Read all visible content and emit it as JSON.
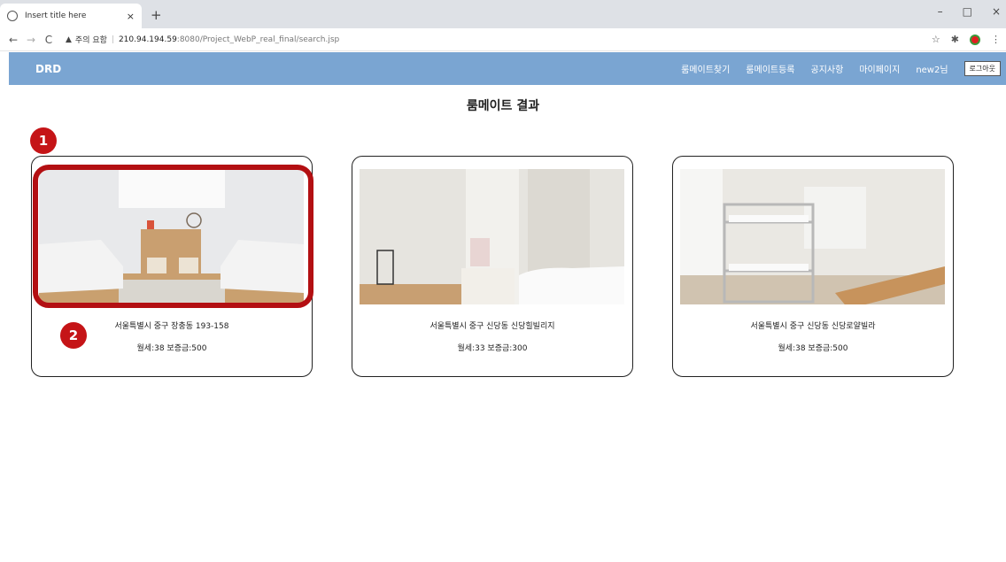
{
  "browser": {
    "tab_title": "Insert title here",
    "tab_close": "×",
    "new_tab": "+",
    "window_controls": [
      "–",
      "□",
      "×"
    ],
    "security_warning": "주의 요함",
    "url_host": "210.94.194.59",
    "url_path": ":8080/Project_WebP_real_final/search.jsp",
    "icons": [
      "back-icon",
      "forward-icon",
      "reload-icon",
      "warning-icon",
      "star-icon",
      "extension-icon",
      "profile-icon",
      "menu-icon"
    ]
  },
  "nav": {
    "logo": "DRD",
    "links": [
      "룸메이트찾기",
      "룸메이트등록",
      "공지사항",
      "마이페이지",
      "new2님"
    ],
    "logout": "로그아웃",
    "bg_color": "#7aa5d2"
  },
  "page": {
    "title": "룸메이트 결과"
  },
  "cards": [
    {
      "address": "서울특별시 중구 장충동 193-158",
      "price": "월세:38 보증금:500"
    },
    {
      "address": "서울특별시 중구 신당동 신당힐빌리지",
      "price": "월세:33 보증금:300"
    },
    {
      "address": "서울특별시 중구 신당동 신당로얄빌라",
      "price": "월세:38 보증금:500"
    }
  ],
  "annotations": {
    "marker1": "1",
    "marker2": "2",
    "color": "#c51417"
  }
}
